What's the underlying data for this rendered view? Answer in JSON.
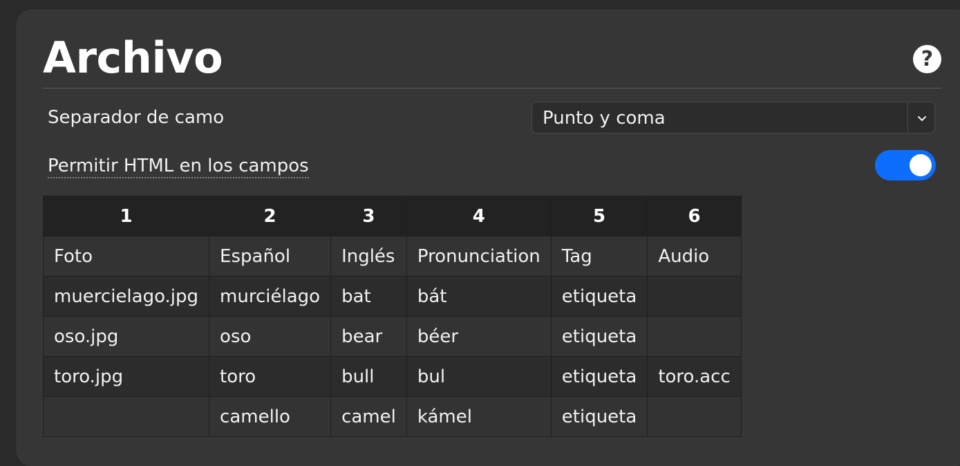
{
  "header": {
    "title": "Archivo",
    "help_icon": "question-circle-icon",
    "help_glyph": "?"
  },
  "field_separator": {
    "label": "Separador de camo",
    "value": "Punto y coma",
    "chevron_icon": "chevron-down-icon"
  },
  "allow_html": {
    "label": "Permitir HTML en los campos",
    "enabled": true,
    "accent_color": "#0d6efd"
  },
  "preview_table": {
    "columns": [
      "1",
      "2",
      "3",
      "4",
      "5",
      "6"
    ],
    "rows": [
      [
        "Foto",
        "Español",
        "Inglés",
        "Pronunciation",
        "Tag",
        "Audio"
      ],
      [
        "muercielago.jpg",
        "murciélago",
        "bat",
        "bát",
        "etiqueta",
        ""
      ],
      [
        "oso.jpg",
        "oso",
        "bear",
        "béer",
        "etiqueta",
        ""
      ],
      [
        "toro.jpg",
        "toro",
        "bull",
        "bul",
        "etiqueta",
        "toro.acc"
      ],
      [
        "",
        "camello",
        "camel",
        "kámel",
        "etiqueta",
        ""
      ]
    ]
  }
}
